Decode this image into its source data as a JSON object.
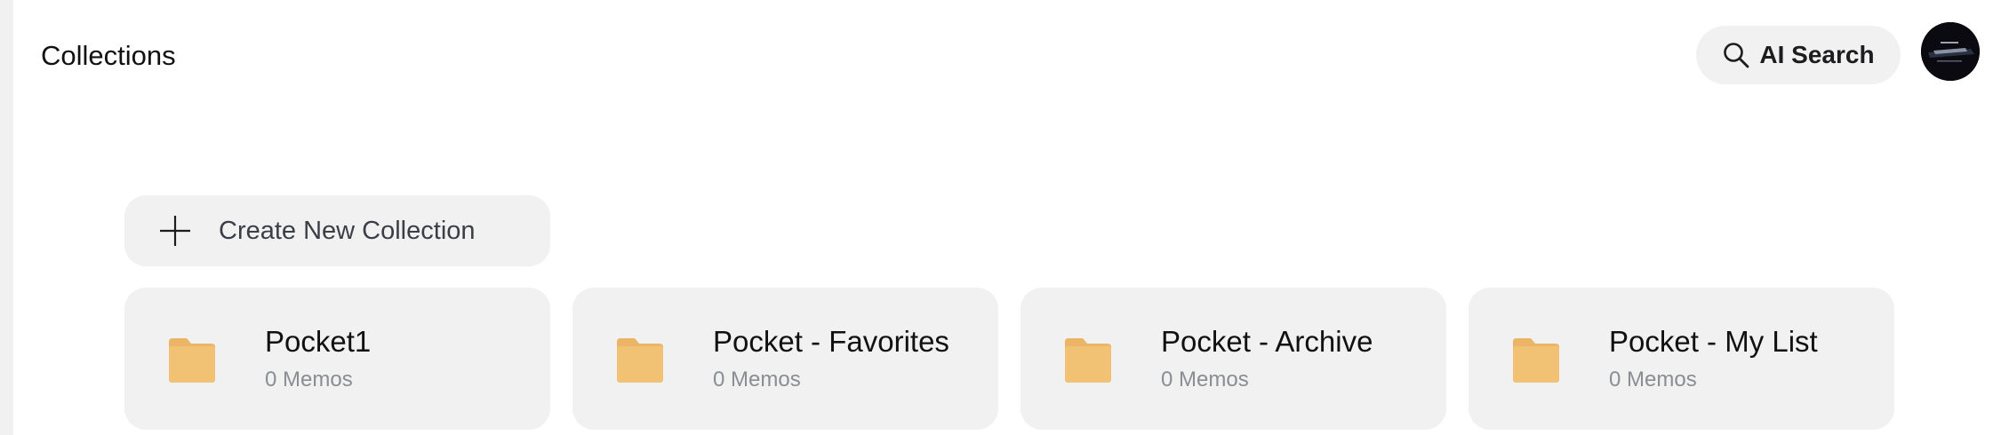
{
  "header": {
    "title": "Collections",
    "ai_search_label": "AI Search"
  },
  "create": {
    "label": "Create New Collection"
  },
  "collections": [
    {
      "name": "Pocket1",
      "count": "0 Memos"
    },
    {
      "name": "Pocket - Favorites",
      "count": "0 Memos"
    },
    {
      "name": "Pocket - Archive",
      "count": "0 Memos"
    },
    {
      "name": "Pocket - My List",
      "count": "0 Memos"
    }
  ],
  "colors": {
    "card_bg": "#f0f1f0",
    "folder": "#f2c274",
    "folder_tab": "#eab666"
  },
  "icons": {
    "search": "search-icon",
    "plus": "plus-icon",
    "folder": "folder-icon"
  }
}
